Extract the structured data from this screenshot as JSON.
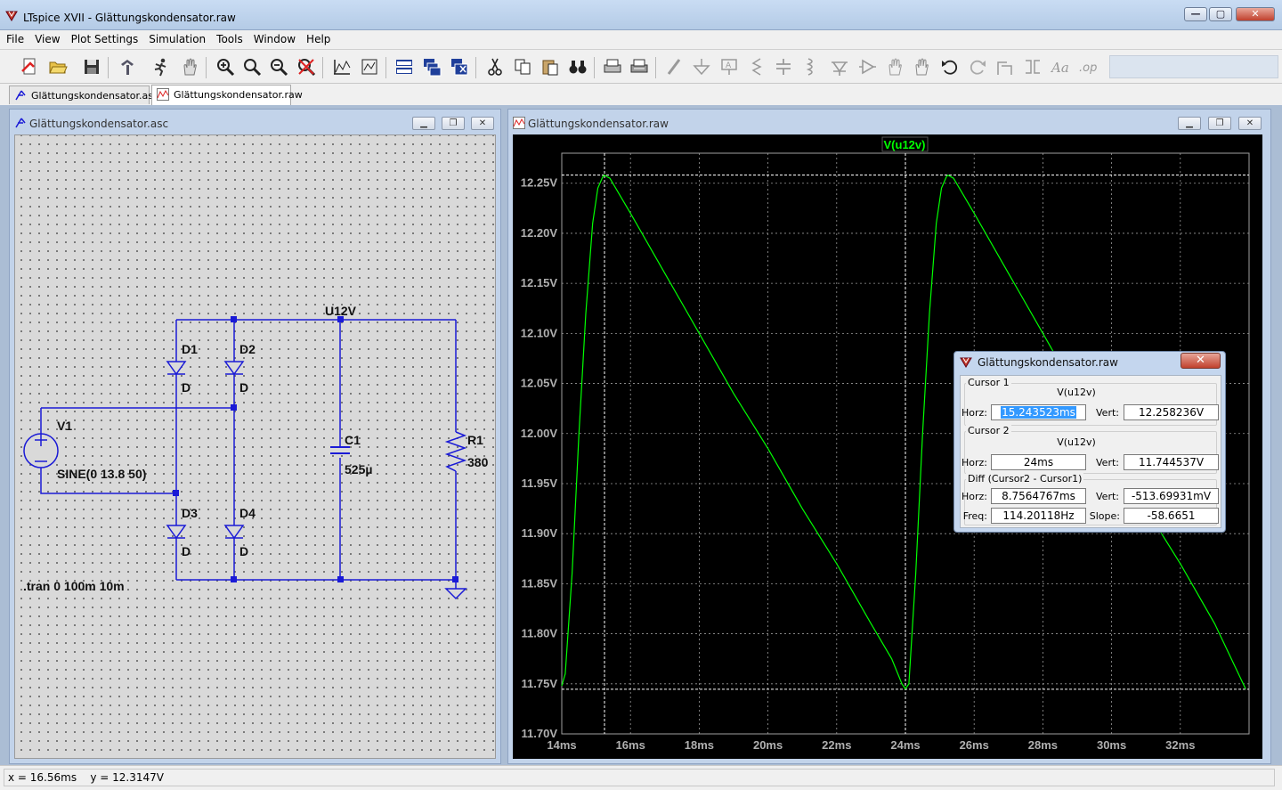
{
  "window": {
    "title": "LTspice XVII - Glättungskondensator.raw",
    "min": "—",
    "max": "▢",
    "close": "✕"
  },
  "menu": [
    "File",
    "View",
    "Plot Settings",
    "Simulation",
    "Tools",
    "Window",
    "Help"
  ],
  "toolbar_icons": [
    "run-icon",
    "open-icon",
    "save-icon",
    "control-panel-icon",
    "run-simulation-icon",
    "halt-icon",
    "zoom-in-icon",
    "zoom-full-icon",
    "zoom-out-icon",
    "zoom-cancel-icon",
    "autorange-icon",
    "vertical-autorange-icon",
    "tile-horizontal-icon",
    "cascade-icon",
    "close-all-icon",
    "cut-icon",
    "copy-icon",
    "paste-icon",
    "find-icon",
    "print-icon",
    "print-setup-icon",
    "wire-icon",
    "ground-icon",
    "label-net-icon",
    "resistor-icon",
    "capacitor-icon",
    "inductor-icon",
    "diode-icon",
    "component-icon",
    "rotate-icon",
    "mirror-icon",
    "undo-icon",
    "redo-icon",
    "text-icon",
    "spice-directive-icon"
  ],
  "tabs": [
    {
      "label": "Glättungskondensator.asc",
      "active": false
    },
    {
      "label": "Glättungskondensator.raw",
      "active": true
    }
  ],
  "schematic": {
    "title": "Glättungskondensator.asc",
    "net_label": "U12V",
    "components": {
      "D1": {
        "name": "D1",
        "value": "D"
      },
      "D2": {
        "name": "D2",
        "value": "D"
      },
      "D3": {
        "name": "D3",
        "value": "D"
      },
      "D4": {
        "name": "D4",
        "value": "D"
      },
      "V1": {
        "name": "V1",
        "value": "SINE(0 13.8 50)"
      },
      "C1": {
        "name": "C1",
        "value": "525µ"
      },
      "R1": {
        "name": "R1",
        "value": "380"
      }
    },
    "directive": ".tran 0 100m 10m"
  },
  "plot": {
    "title": "Glättungskondensator.raw",
    "trace_label": "V(u12v)"
  },
  "chart_data": {
    "type": "line",
    "title": "",
    "xlabel": "",
    "ylabel": "",
    "xlim": [
      14,
      34
    ],
    "ylim": [
      11.7,
      12.28
    ],
    "x_ticks": [
      "14ms",
      "16ms",
      "18ms",
      "20ms",
      "22ms",
      "24ms",
      "26ms",
      "28ms",
      "30ms",
      "32ms"
    ],
    "y_ticks": [
      "11.70V",
      "11.75V",
      "11.80V",
      "11.85V",
      "11.90V",
      "11.95V",
      "12.00V",
      "12.05V",
      "12.10V",
      "12.15V",
      "12.20V",
      "12.25V"
    ],
    "grid": true,
    "series": [
      {
        "name": "V(u12v)",
        "color": "#00ff00",
        "x_ms": [
          14.0,
          14.1,
          14.3,
          14.5,
          14.7,
          14.9,
          15.05,
          15.2,
          15.24,
          15.4,
          16.0,
          17.0,
          18.0,
          19.0,
          20.0,
          21.0,
          22.0,
          23.0,
          23.6,
          23.9,
          24.0,
          24.1,
          24.3,
          24.5,
          24.7,
          24.9,
          25.05,
          25.2,
          25.24,
          25.4,
          26.0,
          27.0,
          28.0,
          29.0,
          30.0,
          31.0,
          32.0,
          33.0,
          33.9
        ],
        "y_v": [
          11.748,
          11.76,
          11.86,
          12.0,
          12.12,
          12.21,
          12.245,
          12.257,
          12.258,
          12.255,
          12.22,
          12.16,
          12.1,
          12.04,
          11.985,
          11.925,
          11.87,
          11.81,
          11.775,
          11.75,
          11.745,
          11.75,
          11.86,
          12.0,
          12.12,
          12.21,
          12.245,
          12.257,
          12.258,
          12.255,
          12.22,
          12.16,
          12.1,
          12.04,
          11.985,
          11.925,
          11.87,
          11.81,
          11.745
        ]
      }
    ],
    "cursors": {
      "cursor1": {
        "x_ms": 15.243523,
        "y_v": 12.258236
      },
      "cursor2": {
        "x_ms": 24,
        "y_v": 11.744537
      }
    }
  },
  "dialog": {
    "title": "Glättungskondensator.raw",
    "close": "✕",
    "cursor1": {
      "label": "Cursor 1",
      "signal": "V(u12v)",
      "horz_label": "Horz:",
      "horz": "15.243523ms",
      "vert_label": "Vert:",
      "vert": "12.258236V"
    },
    "cursor2": {
      "label": "Cursor 2",
      "signal": "V(u12v)",
      "horz_label": "Horz:",
      "horz": "24ms",
      "vert_label": "Vert:",
      "vert": "11.744537V"
    },
    "diff": {
      "label": "Diff (Cursor2 - Cursor1)",
      "horz_label": "Horz:",
      "horz": "8.7564767ms",
      "vert_label": "Vert:",
      "vert": "-513.69931mV",
      "freq_label": "Freq:",
      "freq": "114.20118Hz",
      "slope_label": "Slope:",
      "slope": "-58.6651"
    }
  },
  "status": {
    "text": "x = 16.56ms    y = 12.3147V"
  },
  "colors": {
    "trace": "#00ff00",
    "wire": "#1a1ad6",
    "plot_bg": "#000000",
    "grid": "#9a9a9a"
  }
}
